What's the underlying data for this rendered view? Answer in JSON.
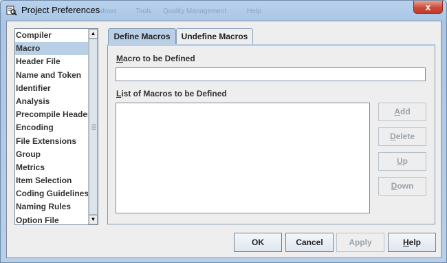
{
  "window": {
    "title": "Project Preferences",
    "menu_bar_ghost": [
      "Windows",
      "Tools",
      "Quality Management",
      "Help"
    ],
    "close_label": "x"
  },
  "sidebar": {
    "items": [
      {
        "label": "Compiler",
        "selected": false
      },
      {
        "label": "Macro",
        "selected": true
      },
      {
        "label": "Header File",
        "selected": false
      },
      {
        "label": "Name and Token",
        "selected": false
      },
      {
        "label": "Identifier",
        "selected": false
      },
      {
        "label": "Analysis",
        "selected": false
      },
      {
        "label": "Precompile Header",
        "selected": false
      },
      {
        "label": "Encoding",
        "selected": false
      },
      {
        "label": "File Extensions",
        "selected": false
      },
      {
        "label": "Group",
        "selected": false
      },
      {
        "label": "Metrics",
        "selected": false
      },
      {
        "label": "Item Selection",
        "selected": false
      },
      {
        "label": "Coding Guidelines",
        "selected": false
      },
      {
        "label": "Naming Rules",
        "selected": false
      },
      {
        "label": "Option File",
        "selected": false
      }
    ]
  },
  "tabs": [
    {
      "label": "Define Macros",
      "active": true
    },
    {
      "label": "Undefine Macros",
      "active": false
    }
  ],
  "define_panel": {
    "macro_label_first": "M",
    "macro_label_rest": "acro to be Defined",
    "macro_value": "",
    "list_label_first": "L",
    "list_label_rest": "ist of Macros to be Defined",
    "macros": [],
    "buttons": {
      "add": {
        "first": "A",
        "rest": "dd",
        "enabled": false
      },
      "delete": {
        "first": "D",
        "rest": "elete",
        "enabled": false
      },
      "up": {
        "first": "U",
        "rest": "p",
        "enabled": false
      },
      "down": {
        "first": "D",
        "rest": "own",
        "enabled": false
      }
    }
  },
  "footer": {
    "ok": "OK",
    "cancel": "Cancel",
    "apply": "Apply",
    "help_first": "H",
    "help_rest": "elp"
  },
  "colors": {
    "selection": "#b8cfe5",
    "title_bar": "#b9d2ec",
    "close_button": "#cc4c3a"
  }
}
